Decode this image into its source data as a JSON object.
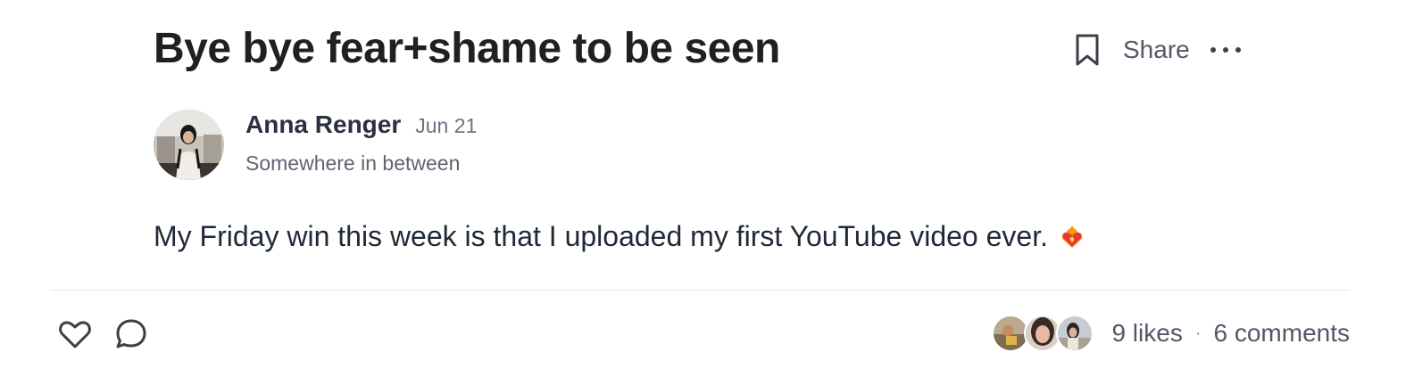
{
  "post": {
    "title": "Bye bye fear+shame to be seen",
    "body": "My Friday win this week is that I uploaded my first YouTube video ever.",
    "body_emoji": "heart-on-fire-emoji"
  },
  "actions": {
    "bookmark_icon": "bookmark-icon",
    "share_label": "Share",
    "more_icon": "more-horizontal-icon"
  },
  "author": {
    "name": "Anna Renger",
    "date": "Jun 21",
    "subtitle": "Somewhere in between"
  },
  "footer": {
    "like_icon": "heart-icon",
    "comment_icon": "comment-bubble-icon",
    "likes_label": "9 likes",
    "separator": "·",
    "comments_label": "6 comments"
  },
  "colors": {
    "text_primary": "#1f2023",
    "text_secondary": "#525866",
    "divider": "#e5e7eb"
  }
}
